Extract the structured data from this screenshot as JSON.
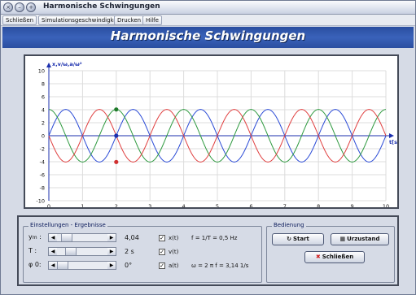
{
  "window": {
    "title": "Harmonische Schwingungen"
  },
  "menu": [
    "Schließen",
    "Simulationsgeschwindigkeit",
    "Drucken",
    "Hilfe"
  ],
  "banner": {
    "title": "Harmonische Schwingungen"
  },
  "chart_data": {
    "type": "line",
    "y_axis_label": "x,v/ω,a/ω²",
    "x_axis_label": "t[s]",
    "xlim": [
      0,
      10
    ],
    "ylim": [
      -10,
      10
    ],
    "x_ticks": [
      "0",
      "1",
      "2",
      "3",
      "4",
      "5",
      "6",
      "7",
      "8",
      "9",
      "10"
    ],
    "y_ticks": [
      "10",
      "8",
      "6",
      "4",
      "2",
      "0",
      "-2",
      "-4",
      "-6",
      "-8",
      "-10"
    ],
    "grid": true,
    "amplitude": 4.04,
    "period": 2,
    "phase": 0,
    "series": [
      {
        "name": "x(t)",
        "color": "#2b4bd6",
        "function": "ym*sin(2*pi*t/T)"
      },
      {
        "name": "v(t)",
        "color": "#2f9a40",
        "function": "ym*cos(2*pi*t/T)"
      },
      {
        "name": "a(t)",
        "color": "#e04040",
        "function": "-ym*sin(2*pi*t/T)"
      }
    ],
    "marker_t": 2,
    "marker_colors": {
      "x": "#2b4bd6",
      "v": "#2f9a40",
      "a": "#d03030"
    }
  },
  "settings": {
    "title": "Einstellungen - Ergebnisse",
    "rows": [
      {
        "label": "y_m :",
        "value": "4,04",
        "thumb": 0.1
      },
      {
        "label": "T :",
        "value": "2 s",
        "thumb": 0.15
      },
      {
        "label": "φ 0:",
        "value": "0°",
        "thumb": 0.0
      }
    ],
    "checkboxes": [
      {
        "label": "x(t)",
        "checked": true
      },
      {
        "label": "v(t)",
        "checked": true
      },
      {
        "label": "a(t)",
        "checked": true
      }
    ],
    "formula_f": "f = 1/T = 0,5 Hz",
    "formula_omega": "ω = 2 π f = 3,14 1/s"
  },
  "controls": {
    "title": "Bedienung",
    "start_label": "Start",
    "reset_label": "Urzustand",
    "close_label": "Schließen"
  }
}
